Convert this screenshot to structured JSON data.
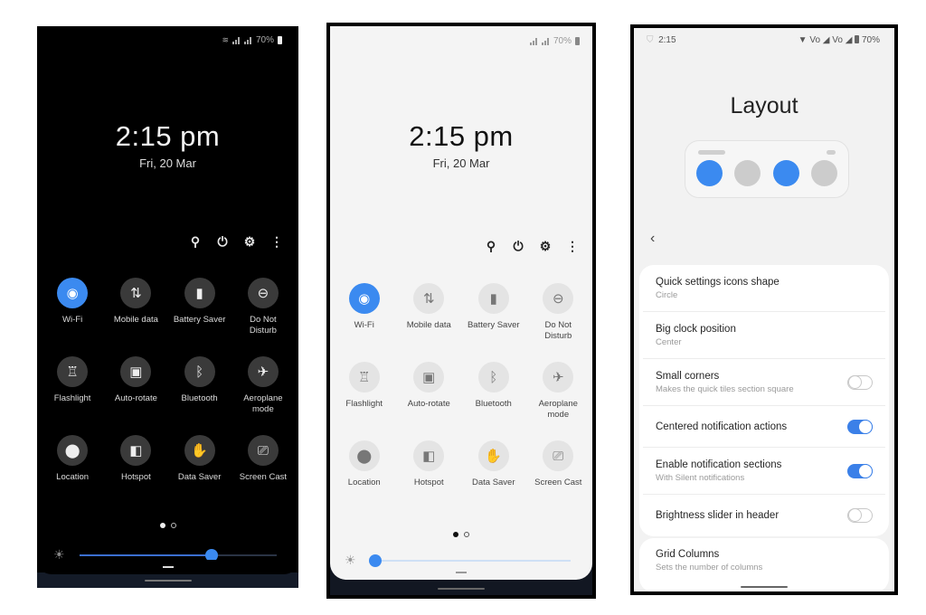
{
  "colors": {
    "accent": "#3b8af0",
    "dark_tile": "#3a3a3a",
    "light_tile": "#e4e4e4",
    "inactive_preview": "#cccccc"
  },
  "dark_panel": {
    "status": {
      "icons": [
        "wifi-signal-icon",
        "cell-signal-icon",
        "cell-signal-icon",
        "battery-icon"
      ],
      "battery": "70%"
    },
    "clock": {
      "time": "2:15 pm",
      "date": "Fri, 20 Mar"
    },
    "actions": [
      {
        "name": "search-icon",
        "glyph": "⚲"
      },
      {
        "name": "power-icon",
        "glyph": "⏻"
      },
      {
        "name": "gear-icon",
        "glyph": "⚙"
      },
      {
        "name": "more-icon",
        "glyph": "⋮"
      }
    ],
    "tiles": [
      {
        "label": "Wi-Fi",
        "icon": "wifi-icon",
        "glyph": "◉",
        "active": true
      },
      {
        "label": "Mobile data",
        "icon": "mobile-data-icon",
        "glyph": "⇅",
        "active": false
      },
      {
        "label": "Battery Saver",
        "icon": "battery-saver-icon",
        "glyph": "▮",
        "active": false
      },
      {
        "label": "Do Not Disturb",
        "icon": "dnd-icon",
        "glyph": "⊖",
        "active": false
      },
      {
        "label": "Flashlight",
        "icon": "flashlight-icon",
        "glyph": "♖",
        "active": false
      },
      {
        "label": "Auto-rotate",
        "icon": "auto-rotate-icon",
        "glyph": "▣",
        "active": false
      },
      {
        "label": "Bluetooth",
        "icon": "bluetooth-icon",
        "glyph": "ᛒ",
        "active": false
      },
      {
        "label": "Aeroplane mode",
        "icon": "airplane-icon",
        "glyph": "✈",
        "active": false
      },
      {
        "label": "Location",
        "icon": "location-icon",
        "glyph": "⬤",
        "active": false
      },
      {
        "label": "Hotspot",
        "icon": "hotspot-icon",
        "glyph": "◧",
        "active": false
      },
      {
        "label": "Data Saver",
        "icon": "data-saver-icon",
        "glyph": "✋",
        "active": false
      },
      {
        "label": "Screen Cast",
        "icon": "screen-cast-icon",
        "glyph": "⎚",
        "active": false
      }
    ],
    "page_indicator": {
      "current": 1,
      "total": 2
    },
    "brightness": 0.67
  },
  "light_panel": {
    "status": {
      "battery": "70%"
    },
    "clock": {
      "time": "2:15 pm",
      "date": "Fri, 20 Mar"
    },
    "page_indicator": {
      "current": 1,
      "total": 2
    },
    "brightness": 0.0
  },
  "settings": {
    "status": {
      "time": "2:15",
      "battery": "70%",
      "indicators": "▼ Vo ◢ Vo ◢"
    },
    "title": "Layout",
    "back_glyph": "‹",
    "rows": [
      {
        "title": "Quick settings icons shape",
        "subtitle": "Circle"
      },
      {
        "title": "Big clock position",
        "subtitle": "Center"
      },
      {
        "title": "Small corners",
        "subtitle": "Makes the quick tiles section square",
        "toggle": false
      },
      {
        "title": "Centered notification actions",
        "toggle": true
      },
      {
        "title": "Enable notification sections",
        "subtitle": "With Silent notifications",
        "toggle": true
      },
      {
        "title": "Brightness slider in header",
        "toggle": false
      }
    ],
    "grid_columns": {
      "title": "Grid Columns",
      "subtitle": "Sets the number of columns"
    }
  }
}
